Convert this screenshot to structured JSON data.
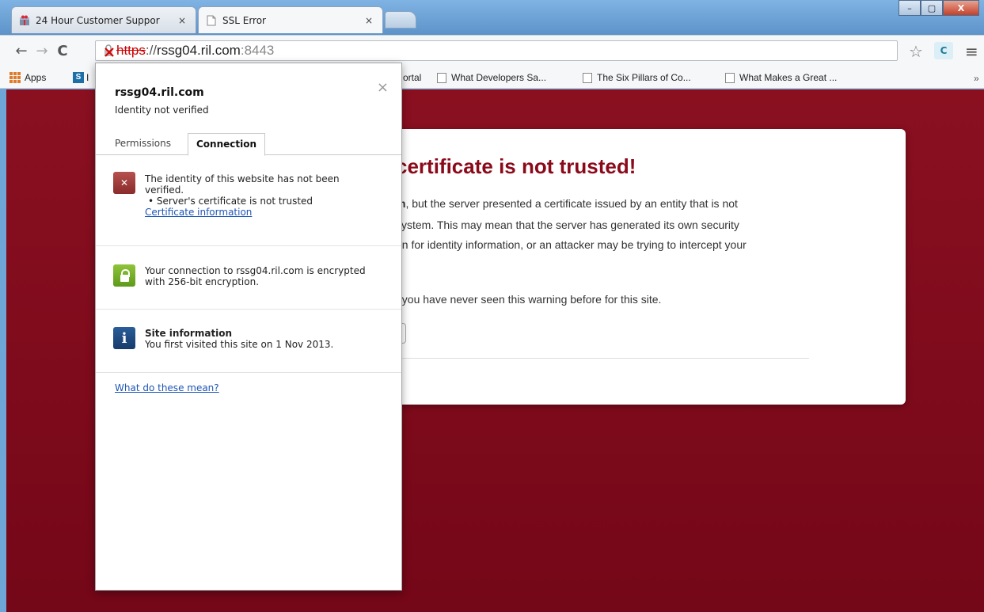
{
  "tabs": [
    {
      "title": "24 Hour Customer Suppor",
      "active": false
    },
    {
      "title": "SSL Error",
      "active": true
    }
  ],
  "window_controls": {
    "minimize": "–",
    "maximize": "▢",
    "close": "X"
  },
  "address_bar": {
    "scheme": "https",
    "separator": "://",
    "host": "rssg04.ril.com",
    "port": ":8443"
  },
  "bookmarks": [
    {
      "label": "Apps"
    },
    {
      "label": "I"
    },
    {
      "label": "ortal"
    },
    {
      "label": "What Developers Sa..."
    },
    {
      "label": "The Six Pillars of Co..."
    },
    {
      "label": "What Makes a Great ..."
    }
  ],
  "bookmarks_more": "»",
  "error_page": {
    "heading": "certificate is not trusted!",
    "lines": [
      "m, but the server presented a certificate issued by an entity that is not",
      "system. This may mean that the server has generated its own security",
      "on for identity information, or an attacker may be trying to intercept your",
      "f you have never seen this warning before for this site."
    ],
    "bold_prefix": "m"
  },
  "popup": {
    "host": "rssg04.ril.com",
    "status": "Identity not verified",
    "close": "×",
    "tabs": [
      {
        "label": "Permissions",
        "active": false
      },
      {
        "label": "Connection",
        "active": true
      }
    ],
    "identity": {
      "line1": "The identity of this website has not been",
      "line2": "verified.",
      "bullet": "• Server's certificate is not trusted",
      "link": "Certificate information"
    },
    "encryption": {
      "line1": "Your connection to rssg04.ril.com is encrypted",
      "line2": "with 256-bit encryption."
    },
    "site_info": {
      "title": "Site information",
      "text": "You first visited this site on 1 Nov 2013."
    },
    "help_link": "What do these mean?"
  }
}
